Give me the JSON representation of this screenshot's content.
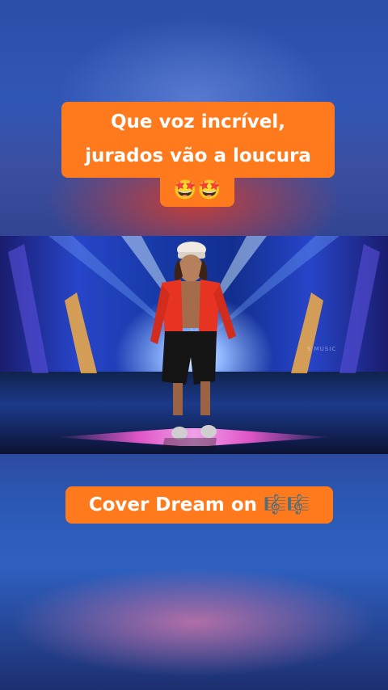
{
  "captions": {
    "top_line1": "Que voz incrível,",
    "top_line2": "jurados vão a loucura",
    "top_emoji": "🤩🤩",
    "bottom": "Cover Dream on 🎼🎼"
  },
  "video": {
    "watermark": "S MUSIC"
  },
  "colors": {
    "caption_background": "#ff7a1c",
    "caption_text": "#ffffff"
  }
}
